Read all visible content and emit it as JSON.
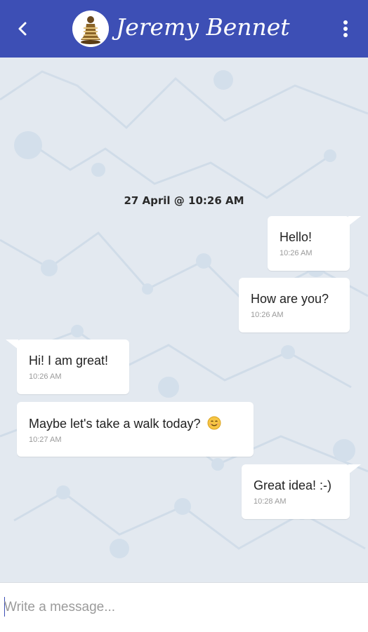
{
  "header": {
    "contact_name": "Jeremy Bennet",
    "back_icon": "chevron-left-icon",
    "menu_icon": "more-vertical-icon",
    "color": "#3d4fb5"
  },
  "chat": {
    "date_separator": "27 April @ 10:26 AM",
    "messages": [
      {
        "direction": "outgoing",
        "text": "Hello!",
        "time": "10:26 AM"
      },
      {
        "direction": "outgoing",
        "text": "How are you?",
        "time": "10:26 AM"
      },
      {
        "direction": "incoming",
        "text": "Hi! I am great!",
        "time": "10:26 AM"
      },
      {
        "direction": "incoming",
        "text": "Maybe let's take a walk today?",
        "emoji": "smiling-face-icon",
        "time": "10:27 AM"
      },
      {
        "direction": "outgoing",
        "text": "Great idea! :-)",
        "time": "10:28 AM"
      }
    ]
  },
  "composer": {
    "placeholder": "Write a message..."
  }
}
